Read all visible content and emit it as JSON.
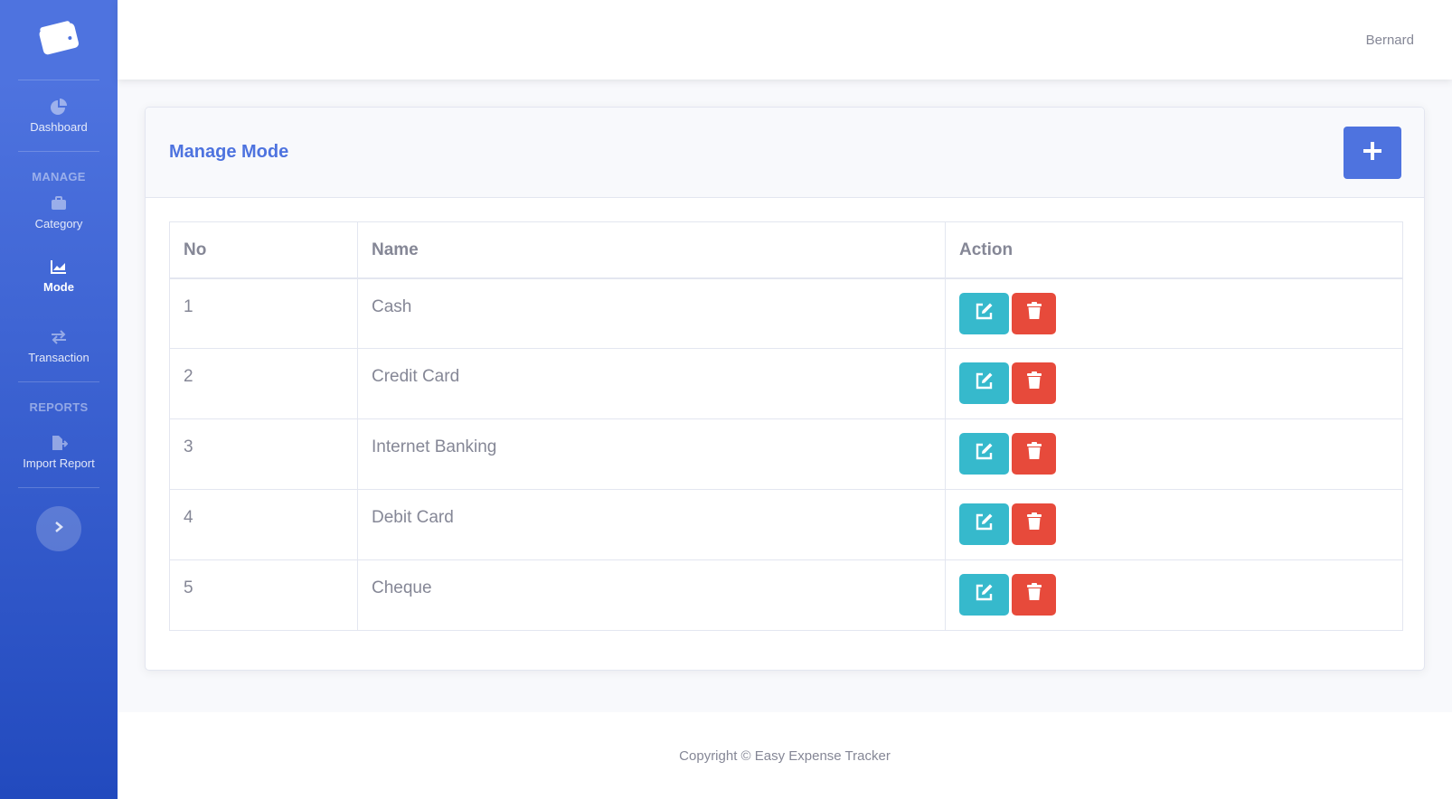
{
  "sidebar": {
    "brand_icon": "wallet-icon",
    "items": [
      {
        "label": "Dashboard",
        "icon": "chart-pie-icon"
      },
      {
        "label": "Category",
        "icon": "briefcase-icon"
      },
      {
        "label": "Mode",
        "icon": "chart-area-icon"
      },
      {
        "label": "Transaction",
        "icon": "exchange-icon"
      },
      {
        "label": "Import Report",
        "icon": "file-export-icon"
      }
    ],
    "headings": {
      "manage": "Manage",
      "reports": "Reports"
    },
    "active": "Mode"
  },
  "topbar": {
    "user_name": "Bernard"
  },
  "card": {
    "title": "Manage Mode",
    "add_button_icon": "plus-icon"
  },
  "table": {
    "headers": [
      "No",
      "Name",
      "Action"
    ],
    "rows": [
      {
        "no": "1",
        "name": "Cash"
      },
      {
        "no": "2",
        "name": "Credit Card"
      },
      {
        "no": "3",
        "name": "Internet Banking"
      },
      {
        "no": "4",
        "name": "Debit Card"
      },
      {
        "no": "5",
        "name": "Cheque"
      }
    ],
    "action_icons": {
      "edit": "edit-icon",
      "delete": "trash-icon"
    }
  },
  "footer": {
    "copyright": "Copyright © Easy Expense Tracker"
  },
  "colors": {
    "primary": "#4e73df",
    "info": "#36b9cc",
    "danger": "#e74a3b",
    "text_muted": "#858796"
  }
}
